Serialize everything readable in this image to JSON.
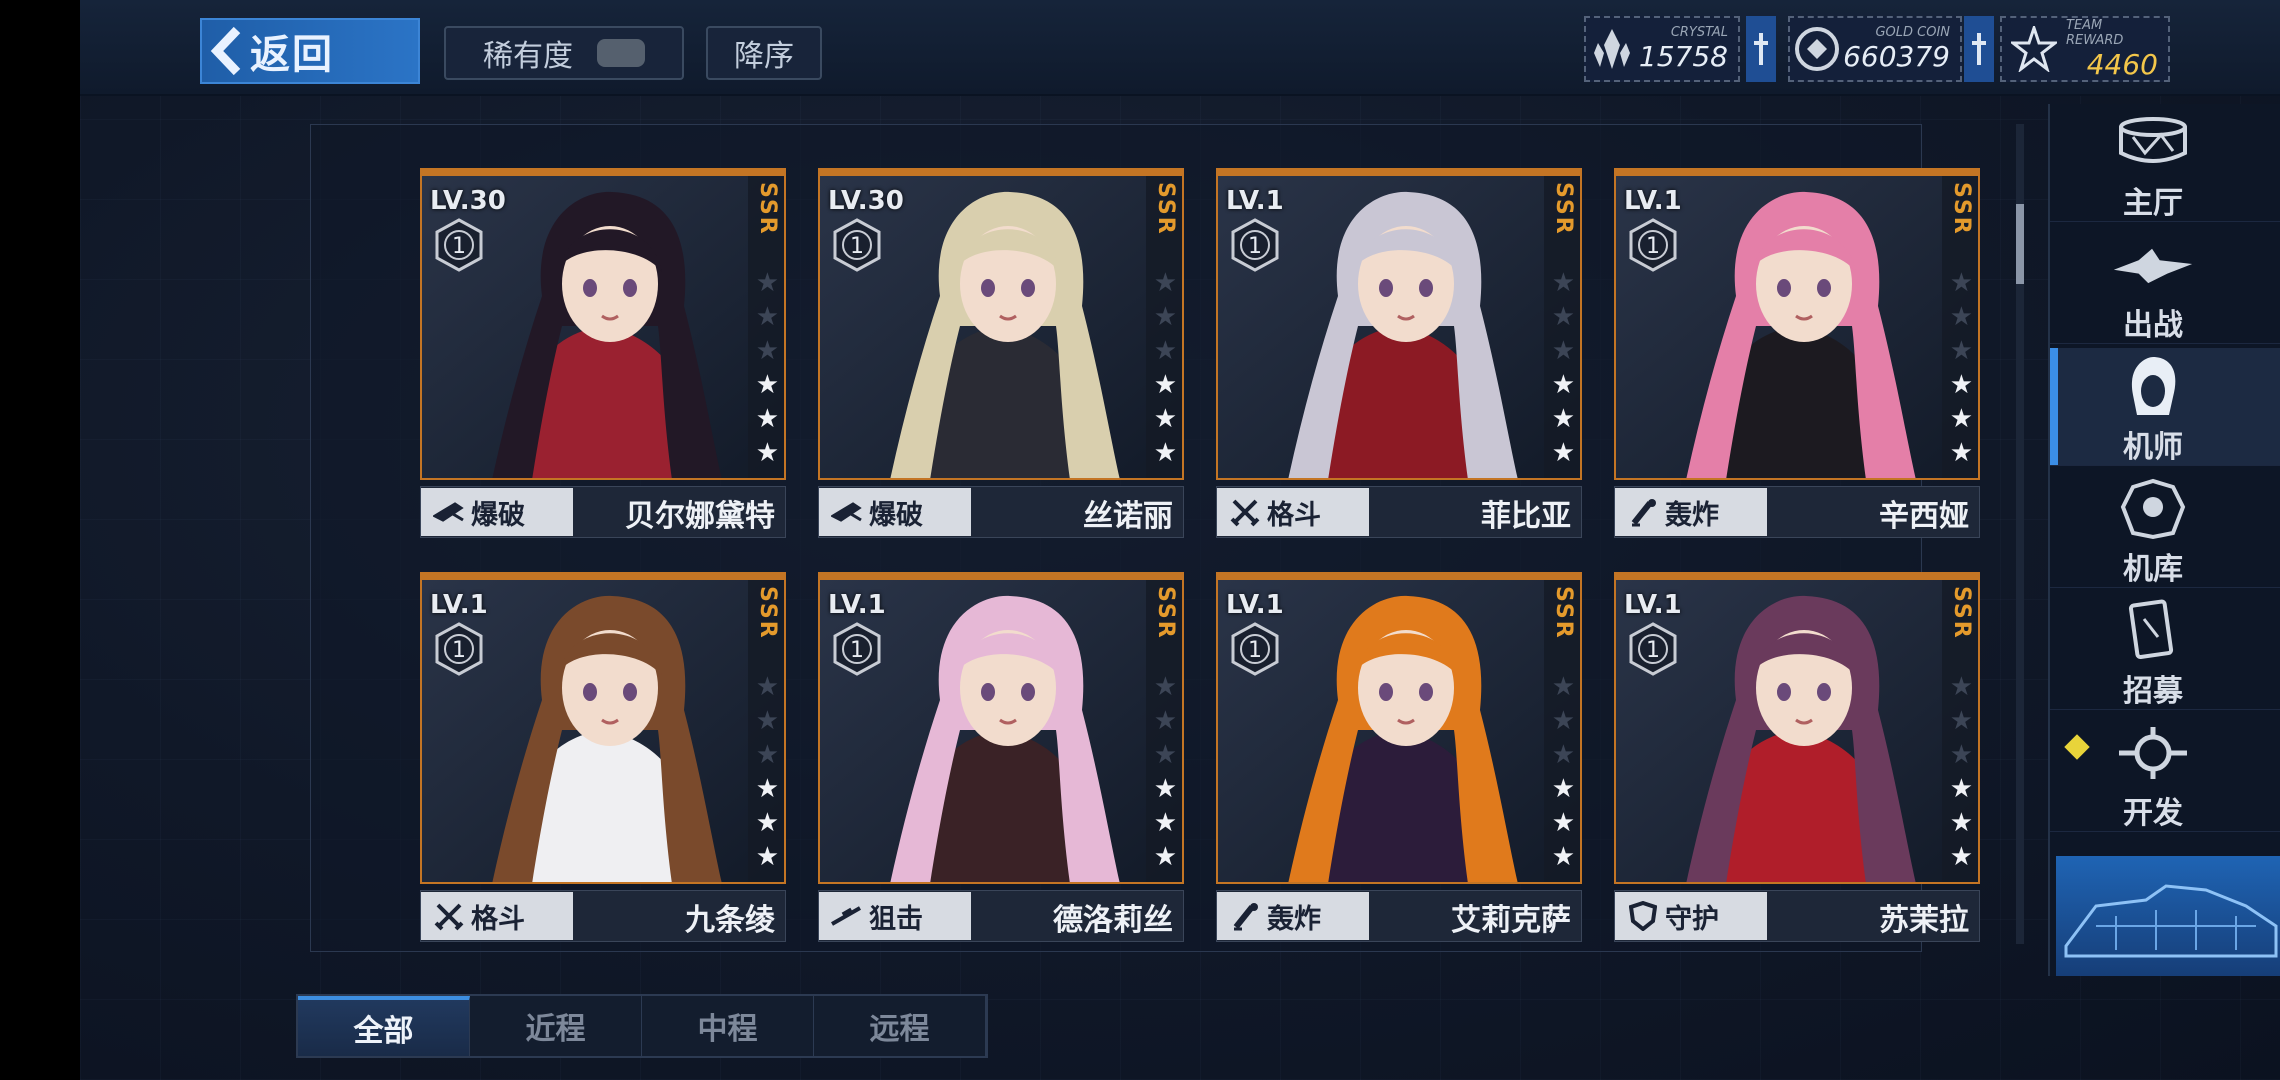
{
  "topbar": {
    "back_label": "返回",
    "sort_rarity_label": "稀有度",
    "sort_order_label": "降序"
  },
  "resources": {
    "crystal": {
      "caption": "CRYSTAL",
      "value": "15758",
      "icon": "crystal-icon"
    },
    "gold": {
      "caption": "GOLD COIN",
      "value": "660379",
      "icon": "coin-icon"
    },
    "team": {
      "caption": "TEAM REWARD",
      "value": "4460",
      "icon": "star-badge-icon"
    }
  },
  "cards": [
    {
      "level": "LV.30",
      "rank": "1",
      "rarity": "SSR",
      "stars": 3,
      "class": "爆破",
      "class_icon": "blaster-icon",
      "name": "贝尔娜黛特",
      "hair": "#221826",
      "accent": "#9a2130"
    },
    {
      "level": "LV.30",
      "rank": "1",
      "rarity": "SSR",
      "stars": 3,
      "class": "爆破",
      "class_icon": "blaster-icon",
      "name": "丝诺丽",
      "hair": "#d9cfae",
      "accent": "#2a2b34"
    },
    {
      "level": "LV.1",
      "rank": "1",
      "rarity": "SSR",
      "stars": 3,
      "class": "格斗",
      "class_icon": "swords-icon",
      "name": "菲比亚",
      "hair": "#c9c6d4",
      "accent": "#8c1a24"
    },
    {
      "level": "LV.1",
      "rank": "1",
      "rarity": "SSR",
      "stars": 3,
      "class": "轰炸",
      "class_icon": "bomb-launcher-icon",
      "name": "辛西娅",
      "hair": "#e47fa8",
      "accent": "#1c1a20"
    },
    {
      "level": "LV.1",
      "rank": "1",
      "rarity": "SSR",
      "stars": 3,
      "class": "格斗",
      "class_icon": "swords-icon",
      "name": "九条绫",
      "hair": "#7a4a2c",
      "accent": "#efeff2"
    },
    {
      "level": "LV.1",
      "rank": "1",
      "rarity": "SSR",
      "stars": 3,
      "class": "狙击",
      "class_icon": "sniper-icon",
      "name": "德洛莉丝",
      "hair": "#e6b8d6",
      "accent": "#3a2226"
    },
    {
      "level": "LV.1",
      "rank": "1",
      "rarity": "SSR",
      "stars": 3,
      "class": "轰炸",
      "class_icon": "bomb-launcher-icon",
      "name": "艾莉克萨",
      "hair": "#e07a1c",
      "accent": "#2c1c3a"
    },
    {
      "level": "LV.1",
      "rank": "1",
      "rarity": "SSR",
      "stars": 3,
      "class": "守护",
      "class_icon": "shield-icon",
      "name": "苏茉拉",
      "hair": "#6a3a5c",
      "accent": "#b01e2a"
    }
  ],
  "nav": [
    {
      "label": "主厅",
      "icon": "lobby-icon"
    },
    {
      "label": "出战",
      "icon": "sortie-icon"
    },
    {
      "label": "机师",
      "icon": "pilot-icon",
      "active": true
    },
    {
      "label": "机库",
      "icon": "hangar-icon"
    },
    {
      "label": "招募",
      "icon": "recruit-icon"
    },
    {
      "label": "开发",
      "icon": "develop-icon",
      "notify": true
    }
  ],
  "tabs": [
    "全部",
    "近程",
    "中程",
    "远程"
  ],
  "colors": {
    "accent": "#3b8ee6",
    "card_border": "#c47524",
    "rarity": "#e49a2c",
    "team_reward": "#f3c64a"
  }
}
